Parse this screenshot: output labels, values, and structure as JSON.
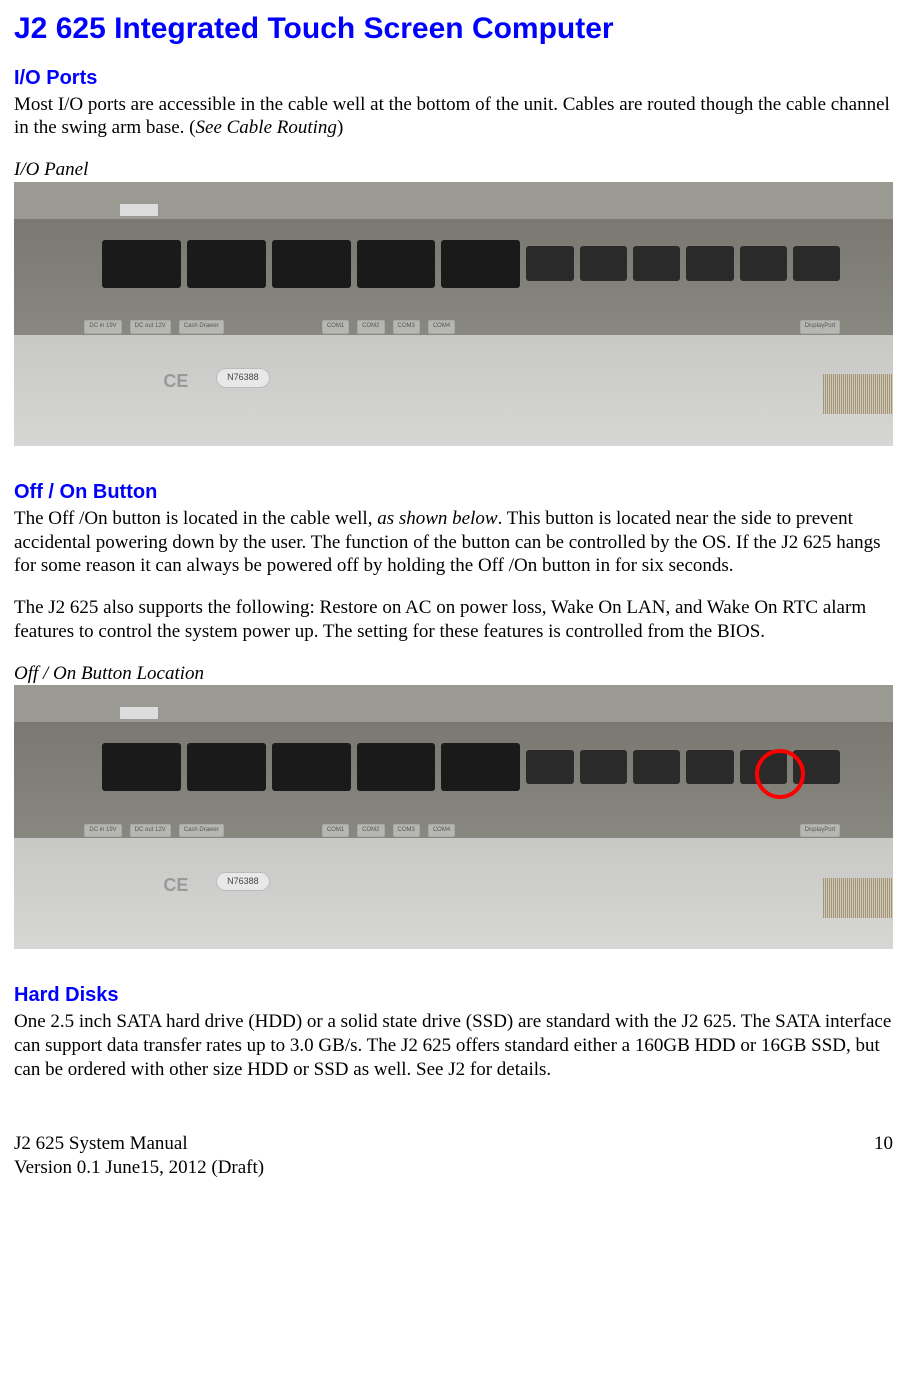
{
  "title": "J2 625 Integrated Touch Screen Computer",
  "sections": {
    "io_ports": {
      "heading": "I/O Ports",
      "body": "Most I/O ports are accessible in the cable well at the bottom of the unit. Cables are routed though the cable channel in the swing arm base. (",
      "body_italic": "See Cable Routing",
      "body_end": ")",
      "figure_label": "I/O Panel"
    },
    "off_on": {
      "heading": "Off / On Button",
      "body1_a": "The Off /On button is located in the cable well, ",
      "body1_italic": "as shown below",
      "body1_b": ".  This button is located near the side to prevent accidental powering down by the user. The function of the button can be controlled by the OS.  If the J2 625 hangs for some reason it can always be powered off by holding the Off /On button in for six seconds.",
      "body2": "The J2 625 also supports the following:  Restore on AC on power loss, Wake On LAN, and Wake On RTC alarm features to control the system power up.  The setting for these features is controlled from the BIOS.",
      "figure_label": "Off / On Button Location"
    },
    "hard_disks": {
      "heading": "Hard Disks",
      "body": "One 2.5 inch SATA hard drive (HDD) or a solid state drive (SSD) are standard with the J2 625. The SATA interface can support data transfer rates up to 3.0 GB/s. The J2 625 offers standard either a 160GB HDD or 16GB SSD, but can be ordered with other size HDD or SSD as well.  See J2 for details."
    }
  },
  "port_labels": {
    "dc_in": "DC in 19V",
    "dc_out": "DC out 12V",
    "cash": "Cash Drawer",
    "com1": "COM1",
    "com2": "COM2",
    "com3": "COM3",
    "com4": "COM4",
    "dp": "DisplayPort"
  },
  "sticker": "N76388",
  "ce": "CE",
  "footer": {
    "manual": "J2 625 System Manual",
    "version": "Version 0.1 June15, 2012 (Draft)",
    "page": "10"
  }
}
